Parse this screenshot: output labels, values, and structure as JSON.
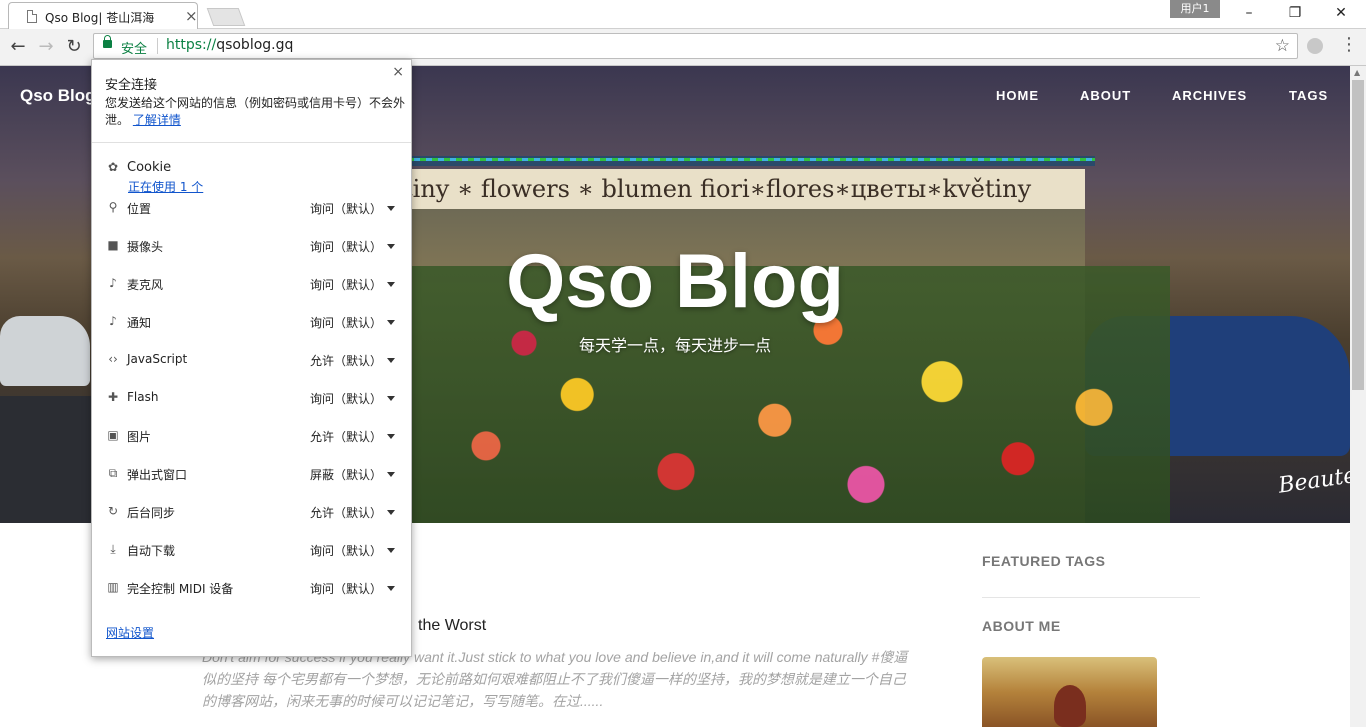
{
  "tab": {
    "title": "Qso Blog| 苍山洱海",
    "close": "×"
  },
  "window": {
    "profile": "用户1",
    "minimize": "–",
    "restore": "❐",
    "close": "✕"
  },
  "toolbar": {
    "back": "←",
    "forward": "→",
    "reload": "↻",
    "secure_label": "安全",
    "url_scheme": "https://",
    "url_host": "qsoblog.gq",
    "star": "☆",
    "menu": "⋮"
  },
  "site": {
    "brand": "Qso Blog",
    "nav": [
      "HOME",
      "ABOUT",
      "ARCHIVES",
      "TAGS"
    ],
    "hero_title": "Qso Blog",
    "hero_subtitle": "每天学一点，每天进步一点",
    "kiosk_sign": "tiny ∗ flowers ∗ blumen      fiori∗flores∗цветы∗květiny",
    "signature": "Beautech."
  },
  "sidebar": {
    "featured_tags": "FEATURED TAGS",
    "about_me": "ABOUT ME"
  },
  "post": {
    "title_fragment": "the Worst",
    "excerpt": "Don't aim for success if you really want it.Just stick to what you love and believe in,and it will come naturally #傻逼似的坚持 每个宅男都有一个梦想，无论前路如何艰难都阻止不了我们傻逼一样的坚持，我的梦想就是建立一个自己的博客网站，闲来无事的时候可以记记笔记，写写随笔。在过......"
  },
  "popup": {
    "close": "×",
    "heading": "安全连接",
    "description": "您发送给这个网站的信息（例如密码或信用卡号）不会外泄。",
    "learn_more": "了解详情",
    "cookie_label": "Cookie",
    "cookie_usage": "正在使用 1 个",
    "permissions": [
      {
        "label": "位置",
        "value": "询问（默认）",
        "icon": "location-pin-icon"
      },
      {
        "label": "摄像头",
        "value": "询问（默认）",
        "icon": "camera-icon"
      },
      {
        "label": "麦克风",
        "value": "询问（默认）",
        "icon": "microphone-icon"
      },
      {
        "label": "通知",
        "value": "询问（默认）",
        "icon": "bell-icon"
      },
      {
        "label": "JavaScript",
        "value": "允许（默认）",
        "icon": "code-brackets-icon"
      },
      {
        "label": "Flash",
        "value": "询问（默认）",
        "icon": "puzzle-icon"
      },
      {
        "label": "图片",
        "value": "允许（默认）",
        "icon": "image-icon"
      },
      {
        "label": "弹出式窗口",
        "value": "屏蔽（默认）",
        "icon": "popup-blocked-icon"
      },
      {
        "label": "后台同步",
        "value": "允许（默认）",
        "icon": "sync-icon"
      },
      {
        "label": "自动下载",
        "value": "询问（默认）",
        "icon": "download-icon"
      },
      {
        "label": "完全控制 MIDI 设备",
        "value": "询问（默认）",
        "icon": "midi-piano-icon"
      }
    ],
    "site_settings": "网站设置"
  },
  "colors": {
    "secure_green": "#0b8043",
    "link_blue": "#1155cc"
  }
}
